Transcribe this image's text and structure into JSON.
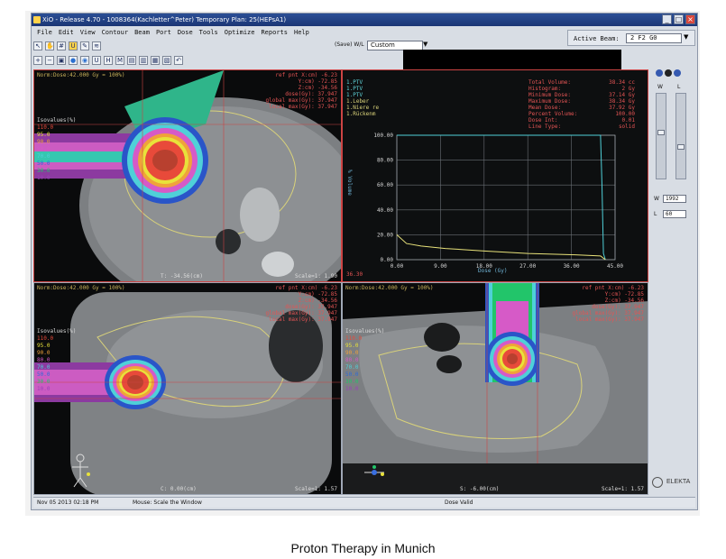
{
  "window": {
    "title": "XiO - Release 4.70 - 1008364(Kachletter^Peter) Temporary Plan: 25(HEPsA1)",
    "buttons": [
      "_",
      "□",
      "×"
    ]
  },
  "menu": [
    "File",
    "Edit",
    "View",
    "Contour",
    "Beam",
    "Port",
    "Dose",
    "Tools",
    "Optimize",
    "Reports",
    "Help"
  ],
  "toolbar": {
    "save_wl": "(Save) W/L",
    "preset": "Custom",
    "icons_row1": [
      "pointer-icon",
      "hand-icon",
      "grid-icon",
      "select-icon",
      "draw-icon",
      "dose-icon"
    ],
    "icons_row2": [
      "zoom-in-icon",
      "zoom-out-icon",
      "fit-icon",
      "color-icon",
      "sphere-icon",
      "u-icon",
      "hs-icon",
      "mr-icon",
      "layout1-icon",
      "layout2-icon",
      "layout3-icon",
      "layout4-icon",
      "undo-icon"
    ]
  },
  "active_beam": {
    "label": "Active Beam:",
    "value": "2 F2 G0"
  },
  "viewports": {
    "axial": {
      "norm": "Norm:Dose:42.000 Gy = 100%)",
      "refpt": [
        "ref pnt X:cm)   -6.23",
        "Y:cm)   -72.85",
        "Z:cm)   -34.56",
        "dose(Gy):  37.947",
        "global max(Gy): 37.947",
        "local max(Gy):  37.947"
      ],
      "isovalues_title": "Isovalues(%)",
      "isovalues": [
        "110.0",
        "95.0",
        "90.0",
        "80.0",
        "70.0",
        "50.0",
        "30.0",
        "10.0"
      ],
      "slice": "T: -34.56(cm)",
      "scale": "Scale=1: 1.90"
    },
    "dvh": {
      "structures": [
        "1.PTV",
        "1.PTV",
        "1.PTV",
        "1.Leber",
        "1.Niere re",
        "1.Rückenm"
      ],
      "stats_labels": [
        "Total Volume:",
        "Histogram:",
        "Minimum Dose:",
        "Maximum Dose:",
        "Mean Dose:",
        "Percent Volume:",
        "Dose Int:",
        "Line Type:"
      ],
      "stats_values": [
        "38.34 cc",
        "2 Gy",
        "37.14 Gy",
        "38.34 Gy",
        "37.92 Gy",
        "100.00",
        "0.01",
        "solid"
      ],
      "ylabel": "% Volume",
      "xlabel": "Dose (Gy)",
      "y_ticks": [
        "100.00",
        "80.00",
        "60.00",
        "40.00",
        "20.00",
        "0.00"
      ],
      "x_ticks": [
        "0.00",
        "9.00",
        "18.00",
        "27.00",
        "36.00",
        "45.00"
      ],
      "corner": "36.30"
    },
    "coronal": {
      "norm": "Norm:Dose:42.000 Gy = 100%)",
      "refpt": [
        "ref pnt X:cm)   -6.23",
        "Y:cm)   -72.85",
        "Z:cm)   -34.56",
        "dose(Gy):  37.947",
        "global max(Gy): 37.947",
        "local max(Gy):  37.947"
      ],
      "isovalues_title": "Isovalues(%)",
      "isovalues": [
        "110.0",
        "95.0",
        "90.0",
        "80.0",
        "70.0",
        "50.0",
        "30.0",
        "10.0"
      ],
      "slice": "C:   0.00(cm)",
      "scale": "Scale=1: 1.57"
    },
    "sagittal": {
      "norm": "Norm:Dose:42.000 Gy = 100%)",
      "refpt": [
        "ref pnt X:cm)   -6.23",
        "Y:cm)   -72.85",
        "Z:cm)   -34.56",
        "dose(Gy):  37.947",
        "global max(Gy): 37.947",
        "local max(Gy):  37.947"
      ],
      "isovalues_title": "Isovalues(%)",
      "isovalues": [
        "110.0",
        "95.0",
        "90.0",
        "80.0",
        "70.0",
        "50.0",
        "30.0",
        "10.0"
      ],
      "slice": "S:  -6.00(cm)",
      "scale": "Scale=1: 1.57"
    }
  },
  "right_panel": {
    "w_label": "W",
    "l_label": "L",
    "w_value": "1992",
    "l_value": "60",
    "brand": "ELEKTA"
  },
  "status": {
    "time": "Nov 05 2013 02:18 PM",
    "mouse": "Mouse:  Scale the Window",
    "dose": "Dose Valid"
  },
  "isovalue_colors": [
    "#e84a3a",
    "#e8e23a",
    "#f0a23a",
    "#d65ac7",
    "#4fd0d8",
    "#2e6bd8",
    "#22c56a",
    "#9a42b8"
  ],
  "caption": "Proton Therapy in Munich",
  "chart_data": {
    "type": "line",
    "xlabel": "Dose (Gy)",
    "ylabel": "% Volume",
    "xlim": [
      0,
      45
    ],
    "ylim": [
      0,
      100
    ],
    "series": [
      {
        "name": "1.PTV",
        "x": [
          0,
          36,
          40,
          42,
          42.3,
          42.6,
          43
        ],
        "y": [
          100,
          100,
          100,
          100,
          60,
          5,
          0
        ]
      },
      {
        "name": "1.Leber",
        "x": [
          0,
          2,
          5,
          10,
          18,
          27,
          36,
          42,
          43
        ],
        "y": [
          20,
          13,
          11,
          9,
          7,
          5,
          4,
          3,
          0
        ]
      }
    ]
  }
}
